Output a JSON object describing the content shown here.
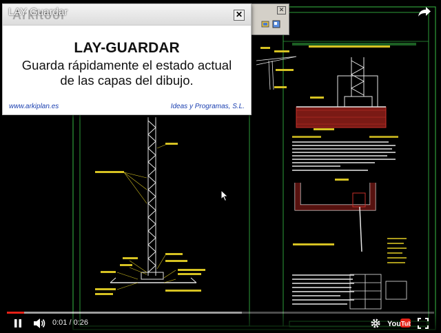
{
  "video": {
    "title": "LAY Guardar",
    "time_current": "0:01",
    "time_total": "0:26",
    "time_separator": " / ",
    "progress": 0.04,
    "buffered": 0.55
  },
  "popup": {
    "header_text": "Arkitool",
    "title": "LAY-GUARDAR",
    "description_line1": "Guarda rápidamente el estado actual",
    "description_line2": "de las capas del dibujo.",
    "link": "www.arkiplan.es",
    "company": "Ideas y Programas, S.L."
  },
  "colors": {
    "progress": "#e62117",
    "cad_green": "#2e9e3a",
    "cad_yellow": "#d6c222",
    "cad_red": "#c8302a",
    "cad_white": "#e8e8e8",
    "link_blue": "#1a3fb0"
  },
  "icons": [
    "share-icon",
    "play-icon",
    "volume-icon",
    "settings-icon",
    "youtube-logo",
    "fullscreen-icon",
    "close-icon",
    "cursor-icon"
  ]
}
